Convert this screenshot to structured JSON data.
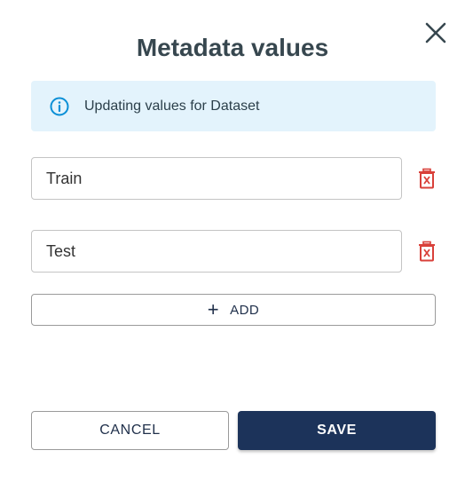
{
  "dialog": {
    "title": "Metadata values",
    "close_icon": "close-icon"
  },
  "info": {
    "icon": "info-icon",
    "text": "Updating values for Dataset",
    "accent_color": "#0a8fd6",
    "background": "#e3f3fc"
  },
  "values": [
    {
      "value": "Train",
      "delete_icon": "trash-icon"
    },
    {
      "value": "Test",
      "delete_icon": "trash-icon"
    }
  ],
  "add_button": {
    "icon": "plus-icon",
    "label": "ADD"
  },
  "actions": {
    "cancel_label": "CANCEL",
    "save_label": "SAVE"
  },
  "colors": {
    "title": "#37474f",
    "primary": "#1c335a",
    "danger": "#d9403a"
  }
}
